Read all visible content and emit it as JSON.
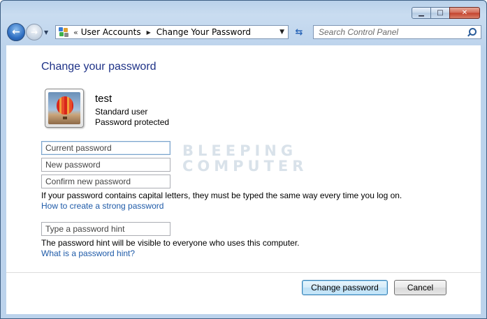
{
  "window": {
    "minimize_symbol": "▁",
    "maximize_symbol": "□",
    "close_symbol": "✕"
  },
  "nav": {
    "back_symbol": "←",
    "forward_symbol": "→",
    "recent_symbol": "▼"
  },
  "address": {
    "overflow": "«",
    "crumbs": [
      "User Accounts",
      "Change Your Password"
    ],
    "separator": "▶",
    "dropdown_symbol": "▼",
    "refresh_symbol": "⇆"
  },
  "search": {
    "placeholder": "Search Control Panel"
  },
  "page": {
    "title": "Change your password",
    "user": {
      "name": "test",
      "type": "Standard user",
      "status": "Password protected"
    },
    "fields": {
      "current_password": "Current password",
      "new_password": "New password",
      "confirm_password": "Confirm new password",
      "hint": "Type a password hint"
    },
    "capital_note": "If your password contains capital letters, they must be typed the same way every time you log on.",
    "strong_password_link": "How to create a strong password",
    "hint_note": "The password hint will be visible to everyone who uses this computer.",
    "hint_link": "What is a password hint?"
  },
  "watermark": {
    "line1": "BLEEPING",
    "line2": "COMPUTER"
  },
  "buttons": {
    "change": "Change password",
    "cancel": "Cancel"
  },
  "colors": {
    "title": "#1e3287",
    "link": "#1e5aa8"
  }
}
